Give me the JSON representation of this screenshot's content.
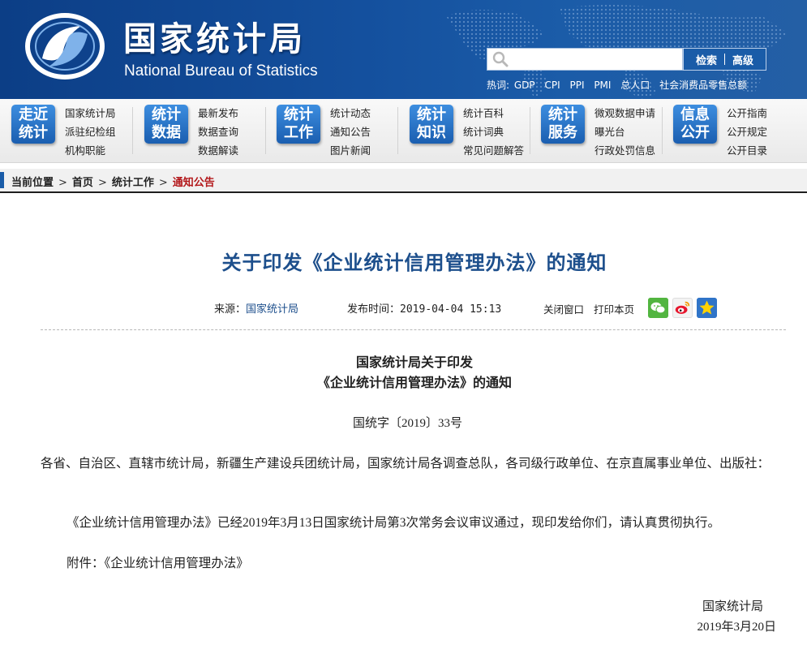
{
  "header": {
    "site_name_cn": "国家统计局",
    "site_name_en": "National Bureau of Statistics",
    "search": {
      "placeholder": "",
      "search_label": "检索",
      "advanced_label": "高级"
    },
    "hotwords_label": "热词:",
    "hotwords": [
      "GDP",
      "CPI",
      "PPI",
      "PMI",
      "总人口",
      "社会消费品零售总额"
    ]
  },
  "nav": {
    "groups": [
      {
        "badge": [
          "走近",
          "统计"
        ],
        "links": [
          "国家统计局",
          "派驻纪检组",
          "机构职能"
        ]
      },
      {
        "badge": [
          "统计",
          "数据"
        ],
        "links": [
          "最新发布",
          "数据查询",
          "数据解读"
        ]
      },
      {
        "badge": [
          "统计",
          "工作"
        ],
        "links": [
          "统计动态",
          "通知公告",
          "图片新闻"
        ]
      },
      {
        "badge": [
          "统计",
          "知识"
        ],
        "links": [
          "统计百科",
          "统计词典",
          "常见问题解答"
        ]
      },
      {
        "badge": [
          "统计",
          "服务"
        ],
        "links": [
          "微观数据申请",
          "曝光台",
          "行政处罚信息"
        ]
      },
      {
        "badge": [
          "信息",
          "公开"
        ],
        "links": [
          "公开指南",
          "公开规定",
          "公开目录"
        ]
      }
    ]
  },
  "breadcrumb": {
    "label": "当前位置",
    "items": [
      "首页",
      "统计工作",
      "通知公告"
    ]
  },
  "article": {
    "title": "关于印发《企业统计信用管理办法》的通知",
    "source_label": "来源：",
    "source": "国家统计局",
    "time_label": "发布时间：",
    "time": "2019-04-04 15:13",
    "close_window": "关闭窗口",
    "print_page": "打印本页",
    "doc_heading_line1": "国家统计局关于印发",
    "doc_heading_line2": "《企业统计信用管理办法》的通知",
    "doc_number": "国统字〔2019〕33号",
    "recipients": "各省、自治区、直辖市统计局，新疆生产建设兵团统计局，国家统计局各调查总队，各司级行政单位、在京直属事业单位、出版社：",
    "body": "《企业统计信用管理办法》已经2019年3月13日国家统计局第3次常务会议审议通过，现印发给你们，请认真贯彻执行。",
    "attachment": "附件：《企业统计信用管理办法》",
    "signature_org": "国家统计局",
    "signature_date": "2019年3月20日"
  },
  "share_icons": [
    "wechat-icon",
    "weibo-icon",
    "favorite-icon"
  ],
  "colors": {
    "header_blue": "#14509e",
    "title_blue": "#1d4f8c",
    "breadcrumb_current": "#b3181b"
  }
}
